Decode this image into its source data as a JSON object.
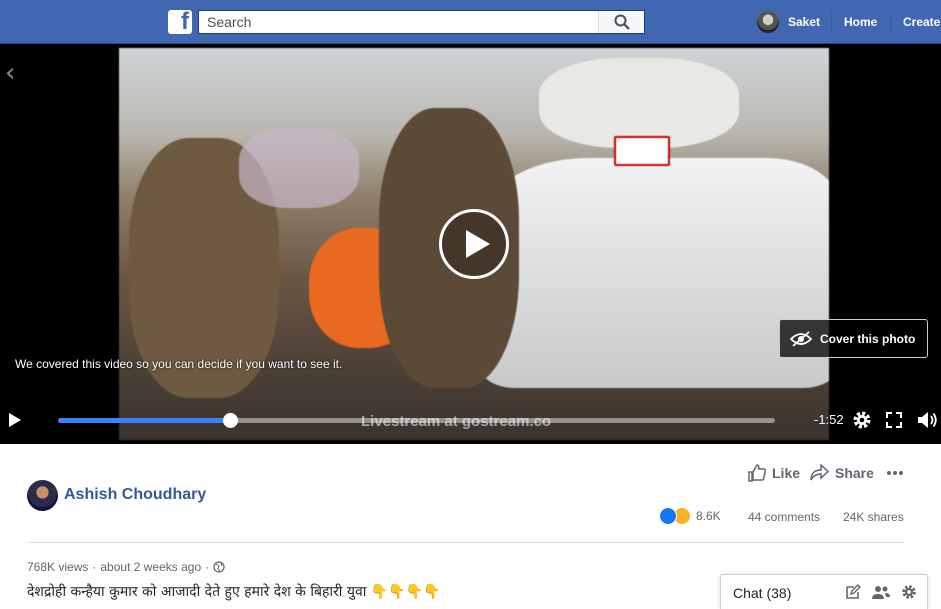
{
  "header": {
    "logo": "f",
    "search": {
      "placeholder": "Search",
      "value": ""
    },
    "user_name": "Saket",
    "links": [
      "Home",
      "Create"
    ]
  },
  "video": {
    "covered_message": "We covered this video so you can decide if you want to see it.",
    "cover_button_label": "Cover this photo",
    "time_remaining": "-1:52",
    "progress": 0.24,
    "watermark": "Livestream at gostream.co"
  },
  "post": {
    "author": "Ashish Choudhary",
    "actions": {
      "like": "Like",
      "share": "Share"
    },
    "reaction_count": "8.6K",
    "comments": "44 comments",
    "shares": "24K shares",
    "views": "768K views",
    "time": "about 2 weeks ago",
    "caption": "देशद्रोही कन्हैया कुमार को आजादी देते हुए हमारे देश के बिहारी युवा 👇👇👇👇"
  },
  "chat": {
    "label": "Chat (38)"
  },
  "colors": {
    "brand": "#4267b2",
    "accent": "#4080ff",
    "link": "#365899"
  }
}
